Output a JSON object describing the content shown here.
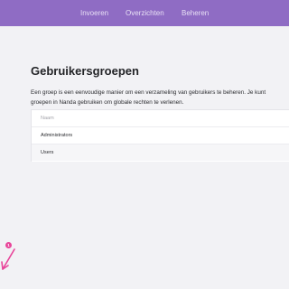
{
  "nav": {
    "items": [
      {
        "label": "Invoeren"
      },
      {
        "label": "Overzichten"
      },
      {
        "label": "Beheren"
      }
    ]
  },
  "page": {
    "title": "Gebruikersgroepen",
    "description": "Een groep is een eenvoudige manier om een verzameling van gebruikers te beheren. Je kunt groepen in Nanda gebruiken om globale rechten te verlenen."
  },
  "groups_table": {
    "header": "Naam",
    "rows": [
      {
        "name": "Administrators"
      },
      {
        "name": "Users"
      }
    ]
  },
  "annotation": {
    "step": "1",
    "color": "#e8459a"
  },
  "colors": {
    "topbar": "#8f6cc4",
    "background": "#f2f2f5"
  }
}
